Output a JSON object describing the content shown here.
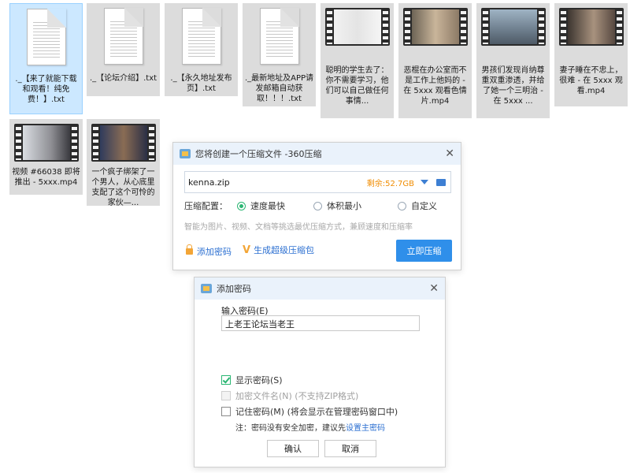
{
  "files": [
    {
      "label": "._【来了就能下载和观看！纯免费！】.txt",
      "type": "txt",
      "selected": true
    },
    {
      "label": "._【论坛介绍】.txt",
      "type": "txt"
    },
    {
      "label": "._【永久地址发布页】.txt",
      "type": "txt"
    },
    {
      "label": "._最新地址及APP请发邮箱自动获取！！！.txt",
      "type": "txt"
    },
    {
      "label": "聪明的学生去了：你不需要学习，他们可以自己做任何事情...",
      "type": "video"
    },
    {
      "label": "恶棍在办公室而不是工作上他妈的 - 在 5xxx 观看色情片.mp4",
      "type": "video"
    },
    {
      "label": "男孩们发现肖纳尊重双重渗透，并给了她一个三明治 - 在 5xxx ...",
      "type": "video"
    },
    {
      "label": "妻子睡在不忠上，很难 - 在 5xxx 观看.mp4",
      "type": "video"
    },
    {
      "label": "视频 #66038 即将推出 - 5xxx.mp4",
      "type": "video"
    },
    {
      "label": "一个疯子绑架了一个男人，从心底里支配了这个可怜的家伙—...",
      "type": "video"
    }
  ],
  "compress_dialog": {
    "title": "您将创建一个压缩文件 -360压缩",
    "filename": "kenna.zip",
    "space_left": "剩余:52.7GB",
    "config_label": "压缩配置：",
    "options": [
      "速度最快",
      "体积最小",
      "自定义"
    ],
    "selected_option": 0,
    "hint": "智能为图片、视频、文档等挑选最优压缩方式，兼顾速度和压缩率",
    "add_password": "添加密码",
    "super_package": "生成超级压缩包",
    "compress_now": "立即压缩"
  },
  "password_dialog": {
    "title": "添加密码",
    "input_label": "输入密码(E)",
    "password_value": "上老王论坛当老王",
    "show_password": "显示密码(S)",
    "encrypt_filename": "加密文件名(N) (不支持ZIP格式)",
    "remember_password": "记住密码(M) (将会显示在管理密码窗口中)",
    "note_prefix": "注：密码没有安全加密，建议先",
    "note_link": "设置主密码",
    "ok": "确认",
    "cancel": "取消"
  }
}
